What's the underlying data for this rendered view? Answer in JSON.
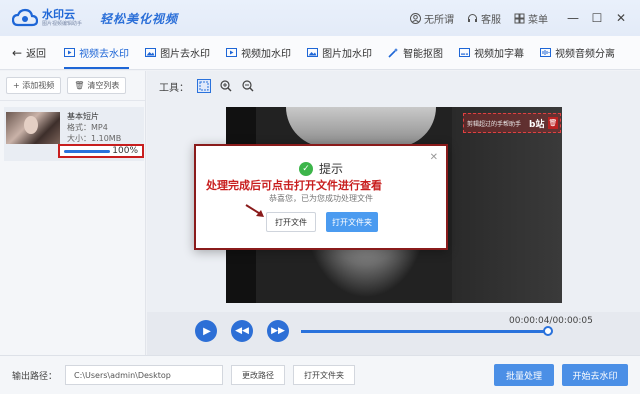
{
  "app": {
    "name": "水印云",
    "tagline": "图片视频编辑助手",
    "slogan": "轻松美化视频"
  },
  "titlebar": {
    "user_label": "无所谓",
    "service_label": "客服",
    "menu_label": "菜单"
  },
  "nav": {
    "back_label": "返回",
    "items": [
      {
        "label": "视频去水印",
        "active": true
      },
      {
        "label": "图片去水印",
        "active": false
      },
      {
        "label": "视频加水印",
        "active": false
      },
      {
        "label": "图片加水印",
        "active": false
      },
      {
        "label": "智能抠图",
        "active": false
      },
      {
        "label": "视频加字幕",
        "active": false
      },
      {
        "label": "视频音频分离",
        "active": false
      }
    ]
  },
  "left": {
    "add_video_label": "+ 添加视频",
    "clear_list_label": "清空列表",
    "file": {
      "name": "基本短片",
      "format": "格式：MP4",
      "size": "大小：1.10MB",
      "progress_percent": 100,
      "progress_text": "100%"
    }
  },
  "workspace": {
    "tools_label": "工具：",
    "watermark_text": "剪辑超过的手帮助手",
    "watermark_logo": "b站"
  },
  "player": {
    "timecode": "00:00:04/00:00:05",
    "progress_fraction": 0.98
  },
  "bottom": {
    "output_label": "输出路径：",
    "output_path": "C:\\Users\\admin\\Desktop",
    "change_path_label": "更改路径",
    "open_folder_label": "打开文件夹",
    "batch_label": "批量处理",
    "start_label": "开始去水印"
  },
  "dialog": {
    "title": "提示",
    "annotation": "处理完成后可点击打开文件进行查看",
    "message": "恭喜您，已为您成功处理文件",
    "open_file_label": "打开文件",
    "open_folder_label": "打开文件夹",
    "close_symbol": "✕"
  },
  "colors": {
    "accent": "#1e66d6",
    "annotation_red": "#c81e1e",
    "success_green": "#3cb54a"
  }
}
